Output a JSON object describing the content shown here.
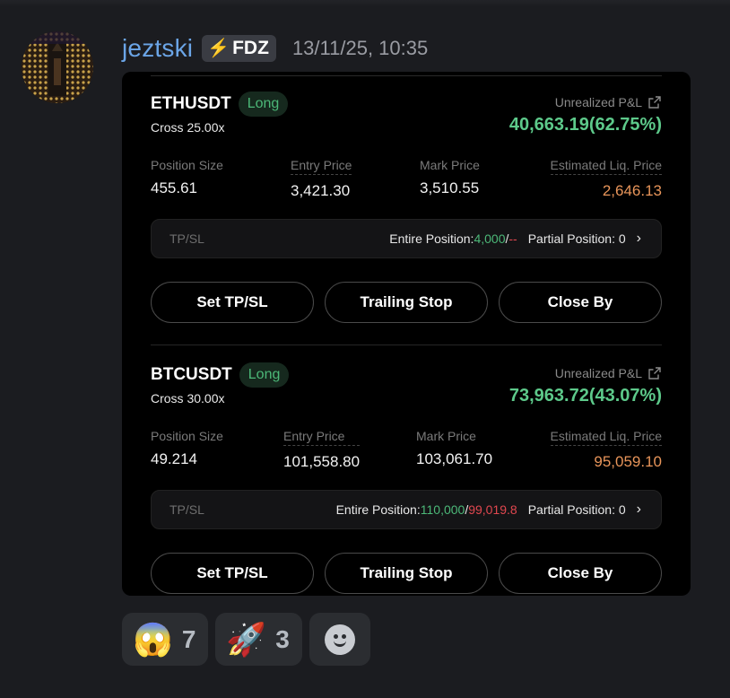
{
  "message": {
    "username": "jeztski",
    "tag_label": "FDZ",
    "tag_icon": "lightning-icon",
    "timestamp": "13/11/25, 10:35",
    "avatar_icon": "avatar-image"
  },
  "positions": [
    {
      "symbol": "ETHUSDT",
      "side": "Long",
      "cross": "Cross 25.00x",
      "pnl_label": "Unrealized P&L",
      "pnl_value": "40,663.19(62.75%)",
      "stats": {
        "size_label": "Position Size",
        "size": "455.61",
        "entry_label": "Entry Price",
        "entry": "3,421.30",
        "mark_label": "Mark Price",
        "mark": "3,510.55",
        "liq_label": "Estimated Liq. Price",
        "liq": "2,646.13"
      },
      "tpsl": {
        "label": "TP/SL",
        "entire_label": "Entire Position: ",
        "tp": "4,000",
        "sep": "/",
        "sl": "--",
        "partial": "Partial Position: 0"
      },
      "buttons": {
        "set": "Set TP/SL",
        "trailing": "Trailing Stop",
        "close": "Close By"
      }
    },
    {
      "symbol": "BTCUSDT",
      "side": "Long",
      "cross": "Cross 30.00x",
      "pnl_label": "Unrealized P&L",
      "pnl_value": "73,963.72(43.07%)",
      "stats": {
        "size_label": "Position Size",
        "size": "49.214",
        "entry_label": "Entry Price",
        "entry": "101,558.80",
        "mark_label": "Mark Price",
        "mark": "103,061.70",
        "liq_label": "Estimated Liq. Price",
        "liq": "95,059.10"
      },
      "tpsl": {
        "label": "TP/SL",
        "entire_label": "Entire Position: ",
        "tp": "110,000",
        "sep": "/",
        "sl": "99,019.8",
        "partial": "Partial Position: 0"
      },
      "buttons": {
        "set": "Set TP/SL",
        "trailing": "Trailing Stop",
        "close": "Close By"
      }
    }
  ],
  "reactions": [
    {
      "emoji": "😱",
      "count": "7"
    },
    {
      "emoji": "🚀",
      "count": "3"
    }
  ],
  "colors": {
    "profit_green": "#5dc98a",
    "loss_red": "#e0474f",
    "liq_orange": "#e8955a",
    "username_blue": "#6ba5e7"
  }
}
